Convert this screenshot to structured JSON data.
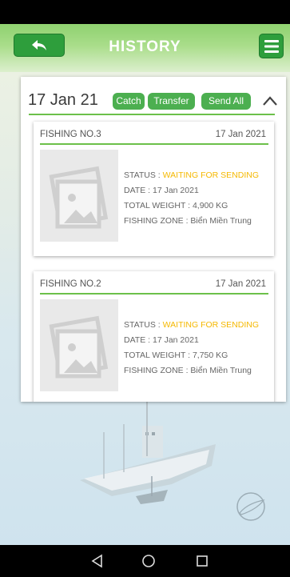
{
  "header": {
    "title": "HISTORY",
    "back_icon": "back-arrow-icon",
    "menu_icon": "hamburger-menu-icon",
    "brand_color": "#2e9e3c"
  },
  "group": {
    "date": "17 Jan 21",
    "actions": {
      "catch": "Catch",
      "transfer": "Transfer",
      "send_all": "Send All"
    },
    "collapse_icon": "chevron-up-icon",
    "accent_color": "#4caf50"
  },
  "trips": [
    {
      "name": "FISHING NO.3",
      "date": "17 Jan 2021",
      "status_label": "STATUS : ",
      "status_value": "WAITING FOR SENDING",
      "date_line": "DATE : 17 Jan 2021",
      "weight_line": "TOTAL WEIGHT : 4,900 KG",
      "zone_line": "FISHING ZONE : Biển Miền Trung"
    },
    {
      "name": "FISHING NO.2",
      "date": "17 Jan 2021",
      "status_label": "STATUS : ",
      "status_value": "WAITING FOR SENDING",
      "date_line": "DATE : 17 Jan 2021",
      "weight_line": "TOTAL WEIGHT : 7,750 KG",
      "zone_line": "FISHING ZONE : Biển Miền Trung"
    }
  ],
  "status_color": "#f5b800",
  "nav": {
    "back_icon": "triangle-back-icon",
    "home_icon": "circle-home-icon",
    "recents_icon": "square-recents-icon"
  }
}
